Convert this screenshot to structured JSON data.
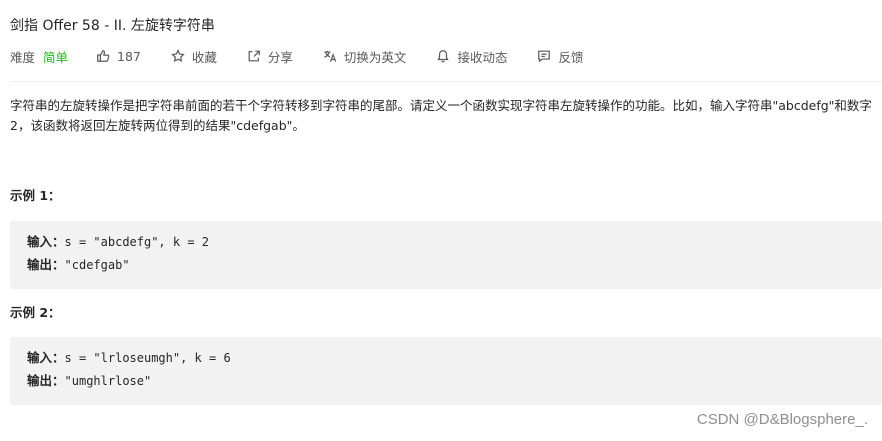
{
  "problem": {
    "title": "剑指 Offer 58 - II. 左旋转字符串"
  },
  "meta": {
    "difficulty_label": "难度",
    "difficulty_value": "简单",
    "likes": "187",
    "collect_label": "收藏",
    "share_label": "分享",
    "translate_label": "切换为英文",
    "notify_label": "接收动态",
    "feedback_label": "反馈",
    "colors": {
      "difficulty_easy": "#1ab91a",
      "code_background": "#f2f2f2"
    },
    "icons": [
      "thumbs-up-icon",
      "star-icon",
      "share-icon",
      "translate-icon",
      "bell-icon",
      "feedback-icon"
    ]
  },
  "description": {
    "text": "字符串的左旋转操作是把字符串前面的若干个字符转移到字符串的尾部。请定义一个函数实现字符串左旋转操作的功能。比如，输入字符串\"abcdefg\"和数字2，该函数将返回左旋转两位得到的结果\"cdefgab\"。"
  },
  "examples": [
    {
      "title": "示例 1：",
      "input_label": "输入：",
      "input_value": "s = \"abcdefg\", k = 2",
      "output_label": "输出：",
      "output_value": "\"cdefgab\""
    },
    {
      "title": "示例 2：",
      "input_label": "输入：",
      "input_value": "s = \"lrloseumgh\", k = 6",
      "output_label": "输出：",
      "output_value": "\"umghlrlose\""
    }
  ],
  "watermark": "CSDN @D&Blogsphere_."
}
